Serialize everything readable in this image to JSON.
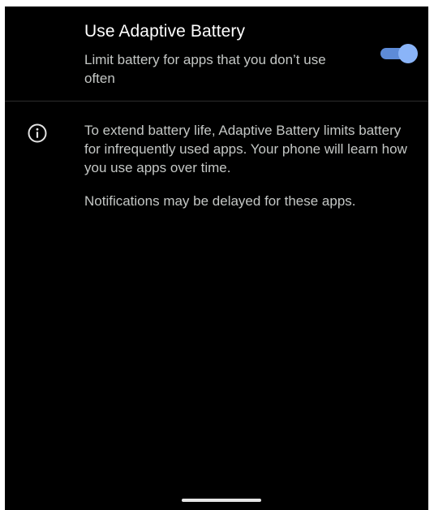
{
  "adaptive_battery": {
    "title": "Use Adaptive Battery",
    "summary": "Limit battery for apps that you don’t use often",
    "toggle_state": "on",
    "accent_color": "#8ab4f8"
  },
  "info": {
    "icon": "info-icon",
    "paragraph_1": "To extend battery life, Adaptive Battery limits battery for infrequently used apps. Your phone will learn how you use apps over time.",
    "paragraph_2": "Notifications may be delayed for these apps."
  }
}
